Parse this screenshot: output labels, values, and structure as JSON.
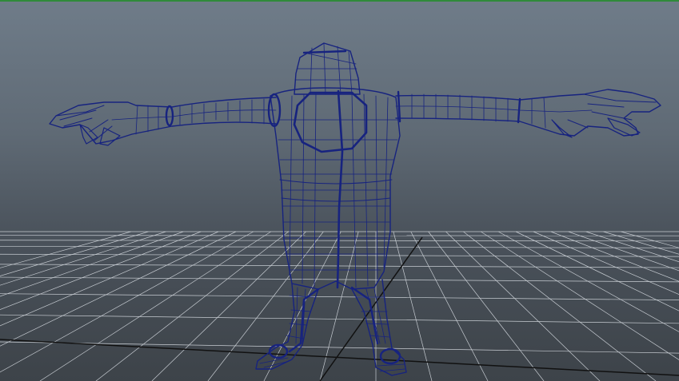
{
  "viewport": {
    "panel": "3d-perspective-viewport",
    "background_top": "#6f7c89",
    "background_bottom": "#3d4349",
    "active_border_color": "#2f8a3a"
  },
  "grid": {
    "line_color": "#c7ccd2",
    "axis_color": "#111111",
    "visible": true
  },
  "model": {
    "type": "t-pose-character",
    "display": "wireframe",
    "wire_color": "#17237f",
    "edge_loop_color": "#0f1a6e"
  }
}
